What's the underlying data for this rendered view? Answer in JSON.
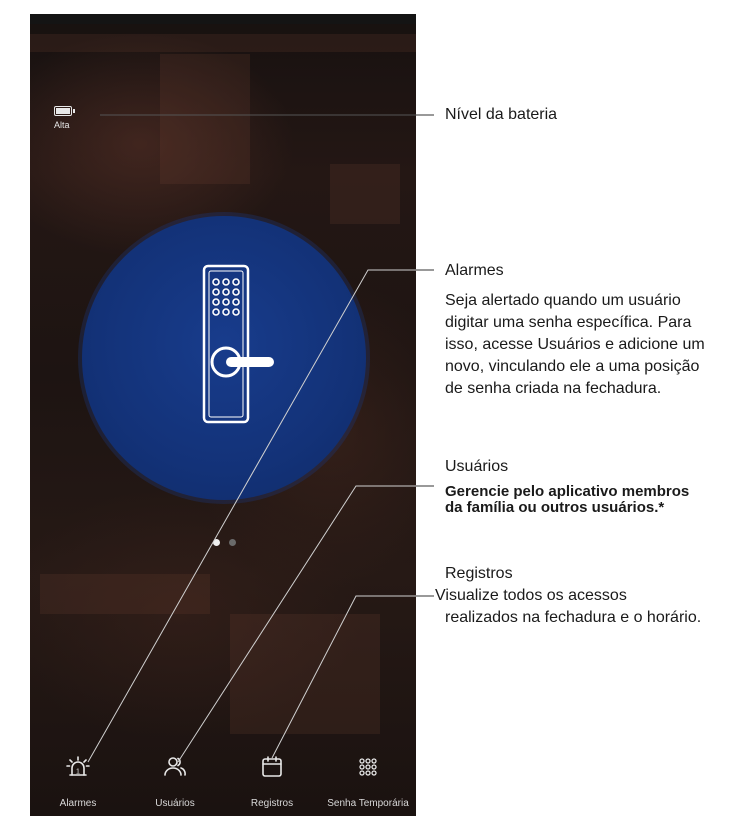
{
  "phone": {
    "battery_label": "Alta",
    "page_indicator": {
      "total": 2,
      "active": 1
    },
    "nav": [
      {
        "label": "Alarmes",
        "icon": "alarm-siren-icon"
      },
      {
        "label": "Usuários",
        "icon": "users-icon"
      },
      {
        "label": "Registros",
        "icon": "calendar-icon"
      },
      {
        "label": "Senha Temporária",
        "icon": "keypad-icon"
      }
    ],
    "colors": {
      "lock_circle": "#133278",
      "background": "#1d1412",
      "icon": "#e8e8e8"
    }
  },
  "annotations": {
    "battery": {
      "title": "Nível da bateria"
    },
    "alarms": {
      "title": "Alarmes",
      "lines": [
        "Seja alertado quando um usuário",
        "digitar uma senha específica. Para",
        "isso, acesse Usuários e adicione um",
        "novo, vinculando ele a uma posição",
        "de senha criada na fechadura."
      ]
    },
    "users": {
      "title": "Usuários",
      "lines": [
        "Gerencie pelo aplicativo membros",
        "da família ou outros usuários.*"
      ]
    },
    "records": {
      "title": "Registros",
      "lines": [
        "Visualize  todos os acessos",
        "realizados na fechadura e o horário."
      ]
    }
  }
}
